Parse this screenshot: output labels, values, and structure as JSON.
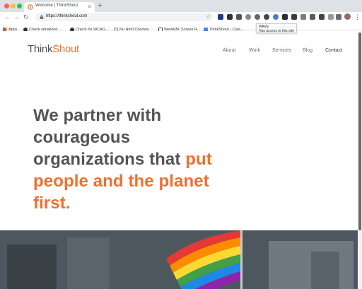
{
  "browser": {
    "tab_title": "Welcome | ThinkShout",
    "tab_close": "×",
    "new_tab": "+",
    "url": "https://thinkshout.com",
    "bookmarks": [
      {
        "label": "Apps"
      },
      {
        "label": "Check serialized..."
      },
      {
        "label": "Check for WCAG..."
      },
      {
        "label": "Nu Html Checker"
      },
      {
        "label": "WebAIM: Screen R..."
      },
      {
        "label": "ThinkShout - Cale..."
      }
    ],
    "tooltip": {
      "title": "WAVE",
      "subtitle": "Has access to this site"
    }
  },
  "site": {
    "logo": {
      "think": "Think",
      "shout": "Shout"
    },
    "nav": [
      {
        "label": "About"
      },
      {
        "label": "Work"
      },
      {
        "label": "Services"
      },
      {
        "label": "Blog"
      },
      {
        "label": "Contact"
      }
    ],
    "hero": {
      "text_plain": "We partner with courageous organizations that",
      "text_highlight": "put people and the planet first."
    }
  },
  "colors": {
    "accent": "#f0702d",
    "heading": "#545454"
  }
}
